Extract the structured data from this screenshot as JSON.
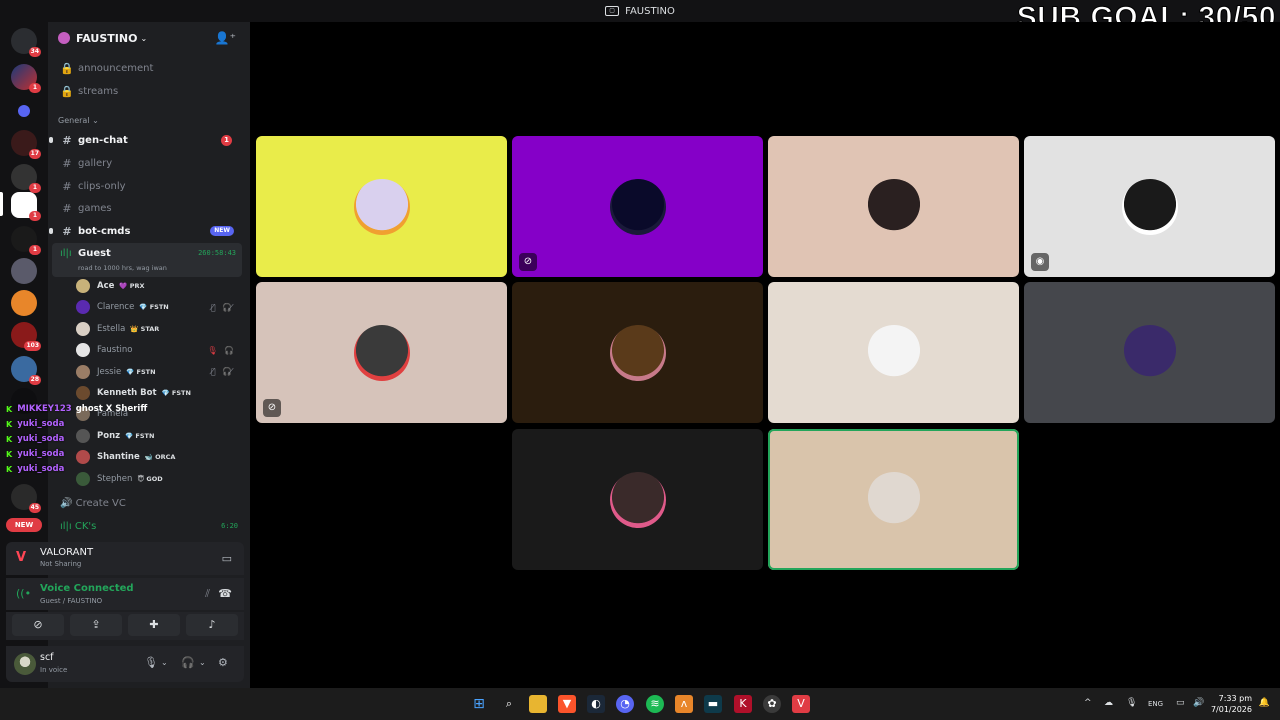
{
  "window": {
    "title": "FAUSTINO"
  },
  "overlay": {
    "sub_goal": "SUB GOAL: 30/50"
  },
  "server_rail": {
    "badges": [
      "34",
      "1",
      "17",
      "1",
      "1",
      "1",
      "103",
      "28",
      "45"
    ],
    "new_label": "NEW"
  },
  "guild": {
    "name": "FAUSTINO"
  },
  "channels": {
    "locked": [
      "announcement",
      "streams"
    ],
    "category": "General",
    "list": [
      {
        "name": "gen-chat",
        "badge": "1"
      },
      {
        "name": "gallery"
      },
      {
        "name": "clips-only"
      },
      {
        "name": "games"
      },
      {
        "name": "bot-cmds",
        "tag": "NEW"
      }
    ]
  },
  "voice_channel": {
    "name": "Guest",
    "topic": "road to 1000 hrs, wag iwan",
    "timer": "260:58:43",
    "members": [
      {
        "name": "Ace",
        "tag": "💜 PRX",
        "bold": true,
        "avatar_color": "#c8b27a"
      },
      {
        "name": "Clarence",
        "tag": "💎 FSTN",
        "icons": "🎙̸ 🎧̸",
        "avatar_color": "#5a2ab0"
      },
      {
        "name": "Estella",
        "tag": "👑 STAR",
        "avatar_color": "#d9cfc4"
      },
      {
        "name": "Faustino",
        "tag": "",
        "icons": "🎙 🎧",
        "red": true,
        "avatar_color": "#e5e5e5"
      },
      {
        "name": "Jessie",
        "tag": "💎 FSTN",
        "icons": "🎙̸ 🎧̸",
        "avatar_color": "#9a7d66"
      },
      {
        "name": "Kenneth Bot",
        "tag": "💎 FSTN",
        "bold": true,
        "avatar_color": "#6b4a2e"
      },
      {
        "name": "Pamela",
        "tag": "",
        "avatar_color": "#7a6a5a"
      },
      {
        "name": "Ponz",
        "tag": "💎 FSTN",
        "bold": true,
        "avatar_color": "#555"
      },
      {
        "name": "Shantine",
        "tag": "🐋 ORCA",
        "bold": true,
        "avatar_color": "#b04a4a"
      },
      {
        "name": "Stephen",
        "tag": "😇 GOD",
        "avatar_color": "#3a5a3a"
      }
    ],
    "create_vc": "Create VC",
    "ck_channel": "CK's",
    "ck_timer": "6:20"
  },
  "chat_overlay": [
    {
      "user": "MIKKEY123",
      "text": "ghost X Sheriff"
    },
    {
      "user": "yuki_soda"
    },
    {
      "user": "yuki_soda"
    },
    {
      "user": "yuki_soda"
    },
    {
      "user": "yuki_soda"
    }
  ],
  "activity": {
    "game": "VALORANT",
    "status": "Not Sharing"
  },
  "voice_status": {
    "label": "Voice Connected",
    "location": "Guest / FAUSTINO"
  },
  "current_user": {
    "name": "scf",
    "status": "In voice"
  },
  "tiles": [
    {
      "bg": "#e9ec4a",
      "ring": "#f0a030",
      "avatar": "#d9d0ee",
      "icon": ""
    },
    {
      "bg": "#8500c8",
      "ring": "#1a1a3a",
      "avatar": "#0a0a2a",
      "icon": "⊘"
    },
    {
      "bg": "#e0c4b4",
      "ring": "#e0c4b4",
      "avatar": "#2a2020",
      "icon": ""
    },
    {
      "bg": "#e2e2e2",
      "ring": "#fff",
      "avatar": "#1a1a1a",
      "icon": "◉"
    },
    {
      "bg": "#d6c3ba",
      "ring": "#e04040",
      "avatar": "#3a3a3a",
      "icon": "⊘"
    },
    {
      "bg": "#2b1d0e",
      "ring": "#c87a8a",
      "avatar": "#5a3a1a",
      "icon": ""
    },
    {
      "bg": "#e4dbd1",
      "ring": "#e4dbd1",
      "avatar": "#f4f4f4",
      "icon": ""
    },
    {
      "bg": "#45474c",
      "ring": "#45474c",
      "avatar": "#3a2a6a",
      "icon": ""
    },
    {
      "bg": "#1a1a1a",
      "ring": "#e05a8a",
      "avatar": "#3a2a2a",
      "icon": ""
    },
    {
      "bg": "#d9c4ab",
      "ring": "#d9c4ab",
      "avatar": "#e0d8d0",
      "icon": "",
      "speaking": true
    }
  ],
  "taskbar": {
    "lang": "ENG",
    "time": "7:33 pm",
    "date": "7/01/2026"
  }
}
